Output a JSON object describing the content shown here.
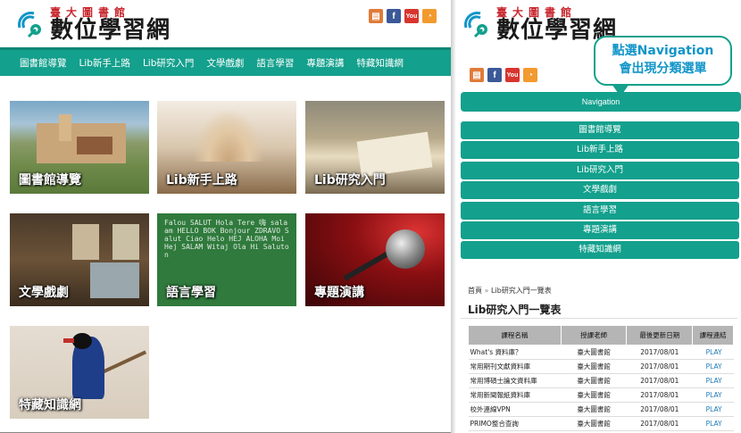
{
  "logo": {
    "top_text": "臺大圖書館",
    "bottom_text": "數位學習網"
  },
  "social_icons": [
    "book-icon",
    "facebook-icon",
    "youtube-icon",
    "rss-icon"
  ],
  "nav": {
    "items": [
      "圖書館導覽",
      "Lib新手上路",
      "Lib研究入門",
      "文學戲劇",
      "語言學習",
      "專題演講",
      "特藏知識網"
    ]
  },
  "tiles": [
    {
      "label": "圖書館導覽"
    },
    {
      "label": "Lib新手上路"
    },
    {
      "label": "Lib研究入門"
    },
    {
      "label": "文學戲劇"
    },
    {
      "label": "語言學習"
    },
    {
      "label": "專題演講"
    },
    {
      "label": "特藏知識網"
    }
  ],
  "language_cloud": {
    "words": "Falou SALUT Hola Tere 嗨 salaam HELLO BOK Bonjour ZDRAVO Salut Ciao Helo HEJ ALOHA Moi Hej SALAM Witaj Ola Hi Saluton"
  },
  "callout": {
    "line1": "點選Navigation",
    "line2": "會出現分類選單"
  },
  "mobile": {
    "nav_button": "Navigation",
    "menu": [
      "圖書館導覽",
      "Lib新手上路",
      "Lib研究入門",
      "文學戲劇",
      "語言學習",
      "專題演講",
      "特藏知識網"
    ],
    "breadcrumb": {
      "home": "首頁",
      "sep": "»",
      "current": "Lib研究入門一覽表"
    },
    "page_title": "Lib研究入門一覽表",
    "table": {
      "headers": [
        "課程名稱",
        "授課老師",
        "最後更新日期",
        "課程連結"
      ],
      "rows": [
        [
          "What's 資料庫？",
          "臺大圖書館",
          "2017/08/01",
          "PLAY"
        ],
        [
          "常用期刊文獻資料庫",
          "臺大圖書館",
          "2017/08/01",
          "PLAY"
        ],
        [
          "常用博碩士論文資料庫",
          "臺大圖書館",
          "2017/08/01",
          "PLAY"
        ],
        [
          "常用新聞報紙資料庫",
          "臺大圖書館",
          "2017/08/01",
          "PLAY"
        ],
        [
          "校外連線VPN",
          "臺大圖書館",
          "2017/08/01",
          "PLAY"
        ],
        [
          "PRIMO整合查詢",
          "臺大圖書館",
          "2017/08/01",
          "PLAY"
        ]
      ]
    }
  },
  "colors": {
    "teal": "#13a08d",
    "logo_red": "#c8262d",
    "link_blue": "#1f7ab8",
    "callout_blue": "#1195c8"
  }
}
